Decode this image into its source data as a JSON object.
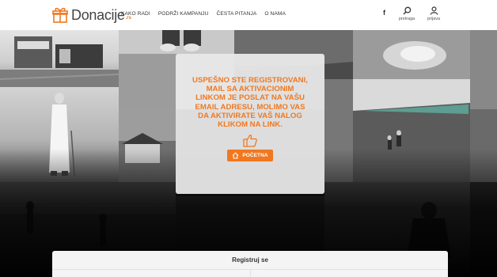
{
  "header": {
    "logo_text": "Donacije",
    "logo_suffix": ".rs",
    "nav": [
      "KAKO RADI",
      "PODRŽI KAMPANJU",
      "ČESTA PITANJA",
      "O NAMA"
    ],
    "facebook_label": "f",
    "search_label": "pretraga",
    "login_label": "prijava"
  },
  "modal": {
    "message": "USPEŠNO STE REGISTROVANI, MAIL SA AKTIVACIONIM LINKOM JE POSLAT NA VAŠU EMAIL ADRESU, MOLIMO VAS DA AKTIVIRATE VAŠ NALOG KLIKOM NA LINK.",
    "home_button": "POČETNA",
    "thumb_icon": "thumbs-up-icon",
    "home_icon": "home-icon"
  },
  "register": {
    "title": "Registruj se"
  },
  "colors": {
    "accent": "#f07820",
    "header_bg": "#ffffff",
    "modal_bg": "#ececec"
  }
}
